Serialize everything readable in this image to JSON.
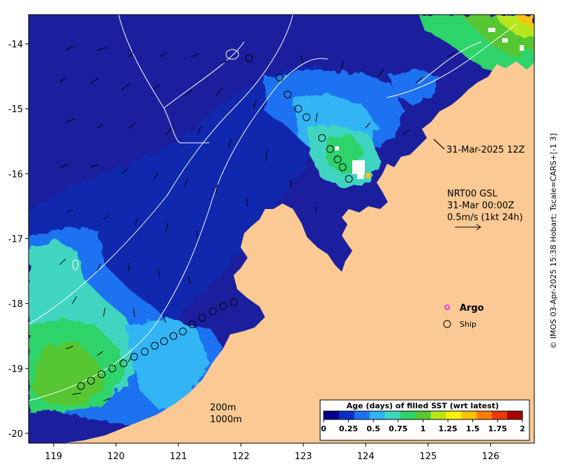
{
  "map": {
    "x_axis": {
      "min": 118.6,
      "max": 126.7,
      "ticks": [
        119,
        120,
        121,
        122,
        123,
        124,
        125,
        126
      ]
    },
    "y_axis": {
      "min": -20.15,
      "max": -13.55,
      "ticks": [
        -14,
        -15,
        -16,
        -17,
        -18,
        -19,
        -20
      ]
    },
    "land_color": "#fbc994",
    "ocean_color": "#1b1f9e"
  },
  "annotations": {
    "timestamp_label": "31-Mar-2025 12Z",
    "product_line1": "NRT00 GSL",
    "product_line2": "31-Mar 00:00Z",
    "product_line3": "0.5m/s (1kt 24h)",
    "contour_200": "200m",
    "contour_1000": "1000m"
  },
  "legend": {
    "argo_label": "Argo",
    "argo_color": "#ff00ff",
    "ship_label": "Ship"
  },
  "colorbar": {
    "title": "Age (days) of filled SST (wrt latest)",
    "tick_labels": [
      "0",
      "0.25",
      "0.5",
      "0.75",
      "1",
      "1.25",
      "1.5",
      "1.75",
      "2"
    ],
    "colors": [
      "#00008b",
      "#0a2fc8",
      "#1d72f0",
      "#33b4f5",
      "#3fd5c0",
      "#2ed36a",
      "#57c733",
      "#b8e61c",
      "#fff20a",
      "#ffc20a",
      "#ff7d0a",
      "#e83a0a",
      "#a80000"
    ]
  },
  "side_credit": "© IMOS 03-Apr-2025 15:38 Hobart; Tscale=CARS+[-1 3]",
  "ship_track": [
    [
      119.44,
      -19.27
    ],
    [
      119.6,
      -19.19
    ],
    [
      119.77,
      -19.09
    ],
    [
      119.94,
      -19.0
    ],
    [
      120.12,
      -18.92
    ],
    [
      120.29,
      -18.82
    ],
    [
      120.46,
      -18.74
    ],
    [
      120.62,
      -18.65
    ],
    [
      120.77,
      -18.58
    ],
    [
      120.92,
      -18.5
    ],
    [
      121.07,
      -18.43
    ],
    [
      121.22,
      -18.32
    ],
    [
      121.38,
      -18.22
    ],
    [
      121.55,
      -18.12
    ],
    [
      121.72,
      -18.04
    ],
    [
      121.89,
      -17.98
    ],
    [
      122.13,
      -14.22
    ],
    [
      122.62,
      -14.52
    ],
    [
      122.75,
      -14.78
    ],
    [
      122.92,
      -15.0
    ],
    [
      123.05,
      -15.13
    ],
    [
      123.3,
      -15.45
    ],
    [
      123.43,
      -15.62
    ],
    [
      123.55,
      -15.78
    ],
    [
      123.63,
      -15.9
    ],
    [
      123.73,
      -16.08
    ]
  ],
  "current_arrows": [
    [
      119.2,
      -14.1,
      0.25,
      0.15
    ],
    [
      119.7,
      -14.1,
      0.3,
      0.1
    ],
    [
      120.2,
      -14.2,
      0.2,
      0.2
    ],
    [
      120.7,
      -14.2,
      0.25,
      0.15
    ],
    [
      121.2,
      -14.2,
      0.3,
      0.1
    ],
    [
      121.7,
      -14.3,
      0.2,
      0.1
    ],
    [
      119.1,
      -14.6,
      0.2,
      0.2
    ],
    [
      119.6,
      -14.6,
      0.25,
      0.15
    ],
    [
      120.1,
      -14.7,
      0.3,
      0.2
    ],
    [
      120.6,
      -14.7,
      0.2,
      0.15
    ],
    [
      121.1,
      -14.8,
      0.25,
      0.2
    ],
    [
      121.6,
      -14.8,
      0.2,
      0.25
    ],
    [
      122.2,
      -15.0,
      0.1,
      0.3
    ],
    [
      119.2,
      -15.2,
      0.3,
      0.1
    ],
    [
      119.7,
      -15.3,
      0.2,
      0.15
    ],
    [
      120.2,
      -15.3,
      0.25,
      0.2
    ],
    [
      120.8,
      -15.4,
      0.2,
      0.25
    ],
    [
      121.3,
      -15.4,
      0.15,
      0.3
    ],
    [
      121.8,
      -15.6,
      0.1,
      0.3
    ],
    [
      122.4,
      -15.8,
      0.05,
      0.35
    ],
    [
      119.1,
      -15.9,
      0.3,
      0.1
    ],
    [
      119.6,
      -15.9,
      0.25,
      0.1
    ],
    [
      120.1,
      -16.0,
      0.2,
      0.2
    ],
    [
      120.6,
      -16.1,
      0.15,
      0.25
    ],
    [
      121.1,
      -16.2,
      0.1,
      0.3
    ],
    [
      121.6,
      -16.3,
      0.05,
      0.3
    ],
    [
      122.1,
      -16.5,
      0.0,
      0.3
    ],
    [
      119.2,
      -16.6,
      0.25,
      0.1
    ],
    [
      119.8,
      -16.7,
      0.2,
      0.15
    ],
    [
      120.3,
      -16.8,
      0.1,
      0.25
    ],
    [
      120.8,
      -16.9,
      0.05,
      0.3
    ],
    [
      121.3,
      -17.0,
      0.0,
      0.3
    ],
    [
      119.1,
      -17.4,
      0.2,
      0.2
    ],
    [
      119.7,
      -17.5,
      0.1,
      0.25
    ],
    [
      120.2,
      -17.5,
      0.05,
      0.3
    ],
    [
      120.7,
      -17.6,
      -0.05,
      0.3
    ],
    [
      121.2,
      -17.7,
      -0.1,
      0.25
    ],
    [
      119.3,
      -18.0,
      0.15,
      0.25
    ],
    [
      119.8,
      -18.2,
      0.05,
      0.3
    ],
    [
      120.3,
      -18.2,
      -0.05,
      0.3
    ],
    [
      120.8,
      -18.3,
      -0.1,
      0.25
    ],
    [
      119.2,
      -18.7,
      0.25,
      0.1
    ],
    [
      119.7,
      -18.8,
      0.2,
      0.15
    ],
    [
      120.2,
      -18.9,
      0.1,
      0.2
    ],
    [
      119.3,
      -19.4,
      0.3,
      0.05
    ],
    [
      119.8,
      -19.5,
      0.25,
      0.1
    ],
    [
      123.0,
      -14.3,
      -0.1,
      0.3
    ],
    [
      123.6,
      -14.4,
      0.1,
      0.3
    ],
    [
      124.2,
      -14.5,
      0.2,
      0.25
    ],
    [
      124.8,
      -14.6,
      0.25,
      0.2
    ],
    [
      125.3,
      -14.2,
      0.3,
      0.15
    ],
    [
      123.2,
      -15.2,
      0.05,
      0.3
    ],
    [
      124.0,
      -15.3,
      0.15,
      0.2
    ],
    [
      124.6,
      -15.4,
      0.2,
      0.15
    ],
    [
      122.8,
      -16.2,
      0.0,
      0.25
    ],
    [
      123.2,
      -16.6,
      0.0,
      0.2
    ]
  ]
}
